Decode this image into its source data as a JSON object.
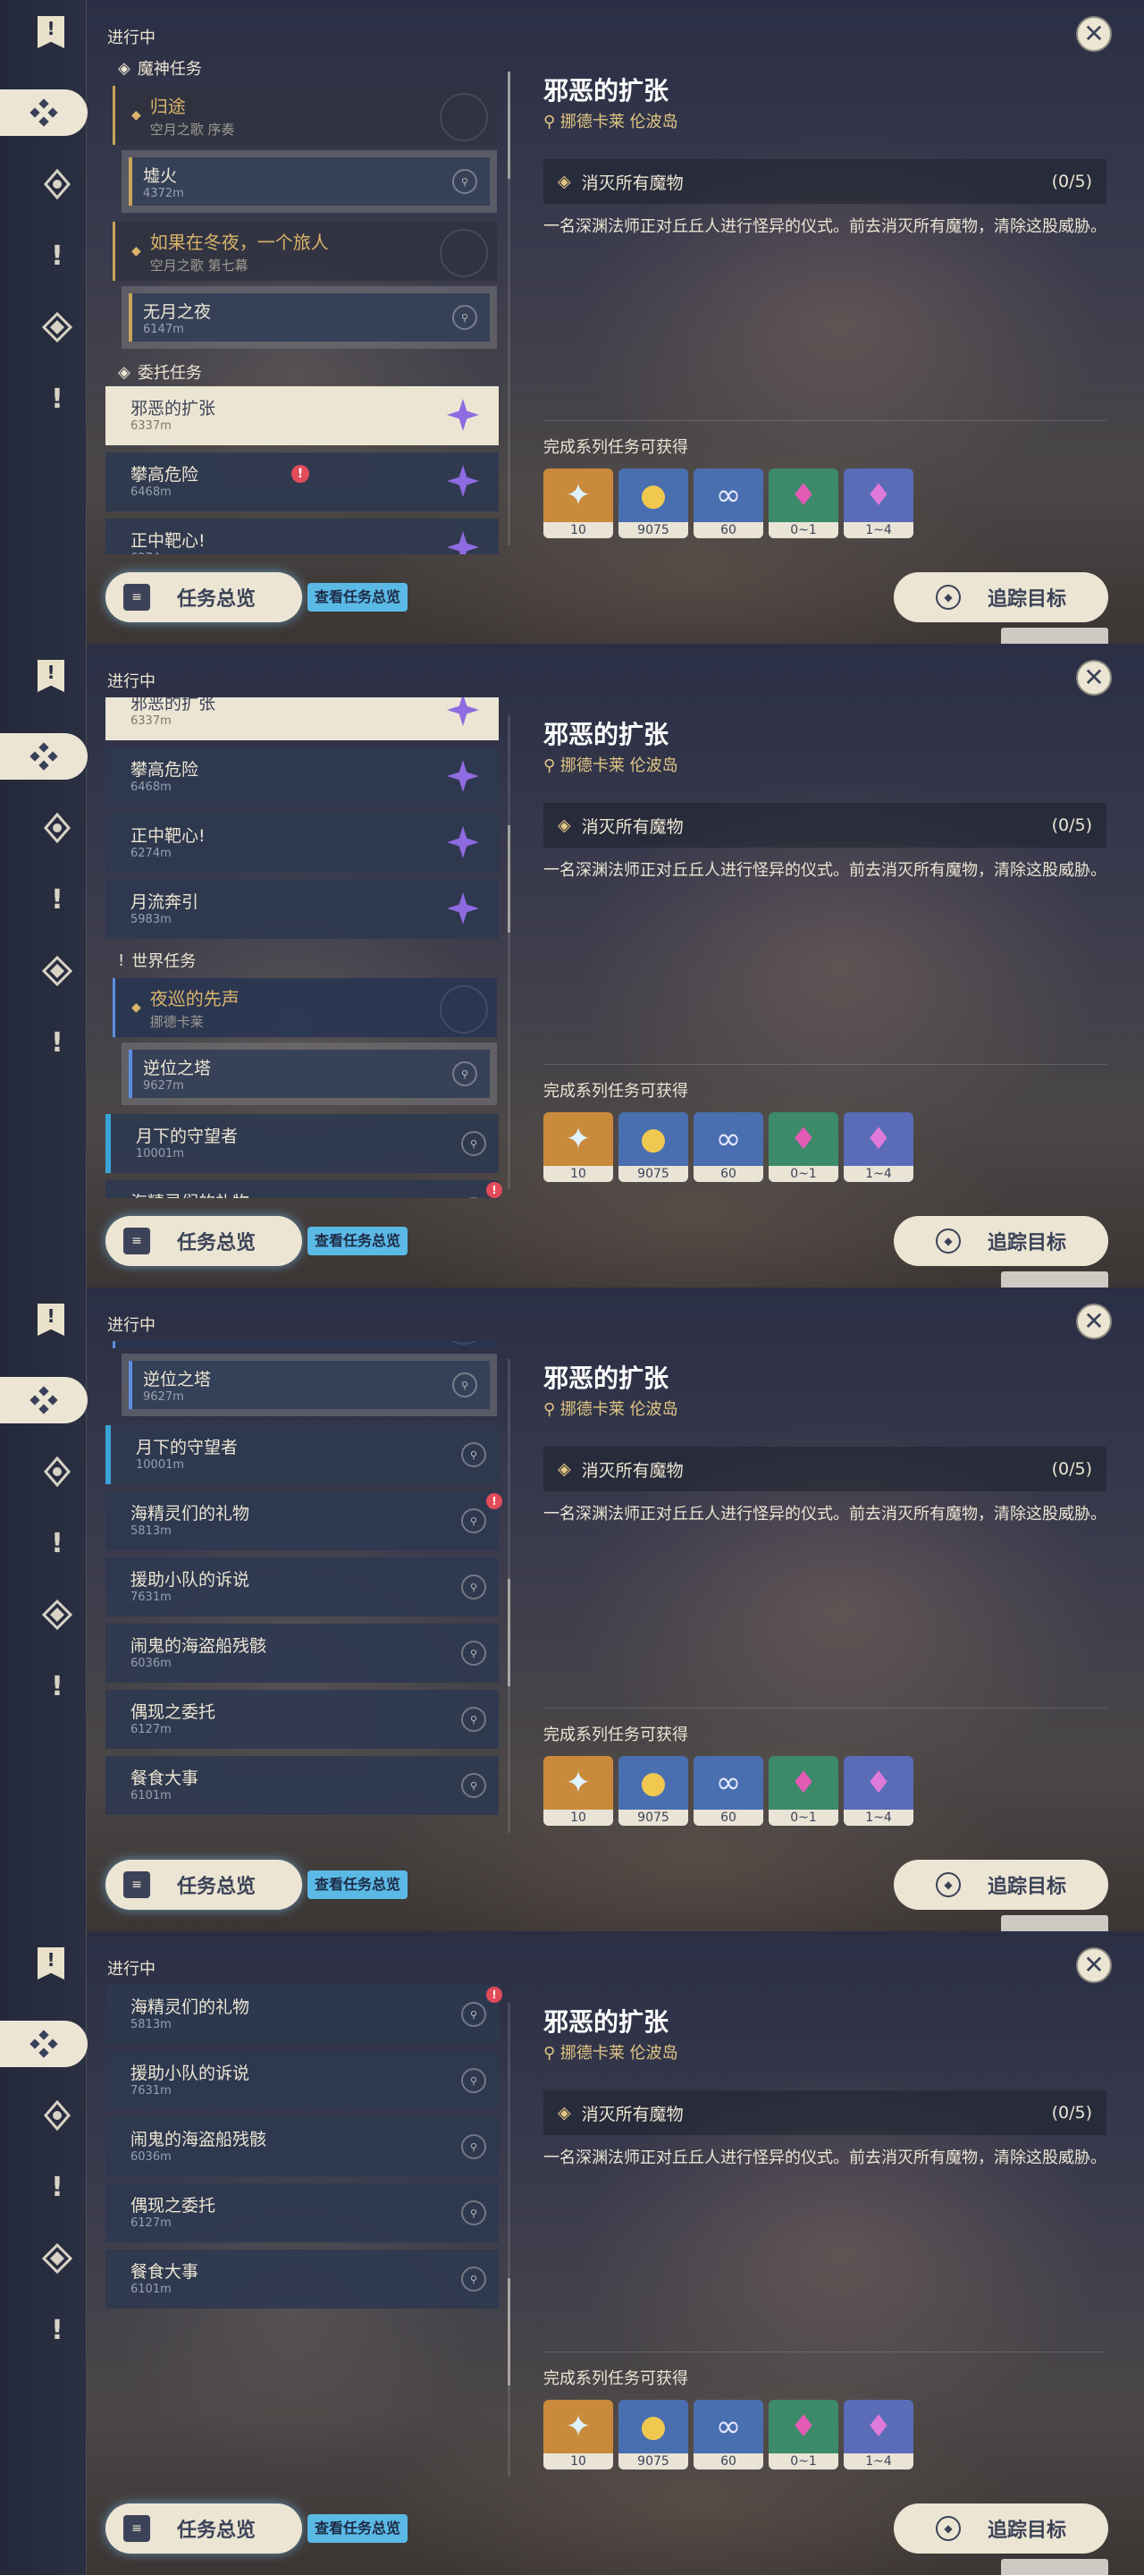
{
  "ui": {
    "status": "进行中",
    "overview_label": "任务总览",
    "overview_hint": "查看任务总览",
    "track_label": "追踪目标",
    "close_glyph": "✕"
  },
  "sections": {
    "archon": "魔神任务",
    "commission": "委托任务",
    "world": "世界任务"
  },
  "archon_quests": [
    {
      "title": "归途",
      "subtitle": "空月之歌 序奏",
      "step": "墟火",
      "distance": "4372m"
    },
    {
      "title": "如果在冬夜，一个旅人",
      "subtitle": "空月之歌 第七幕",
      "step": "无月之夜",
      "distance": "6147m"
    }
  ],
  "commissions": [
    {
      "title": "邪恶的扩张",
      "distance": "6337m"
    },
    {
      "title": "攀高危险",
      "distance": "6468m"
    },
    {
      "title": "正中靶心!",
      "distance": "6274m"
    },
    {
      "title": "月流奔引",
      "distance": "5983m"
    }
  ],
  "world_quest_main": {
    "title": "夜巡的先声",
    "subtitle": "挪德卡莱",
    "step": "逆位之塔",
    "distance": "9627m"
  },
  "world_quests": [
    {
      "title": "月下的守望者",
      "distance": "10001m"
    },
    {
      "title": "海精灵们的礼物",
      "distance": "5813m"
    },
    {
      "title": "援助小队的诉说",
      "distance": "7631m"
    },
    {
      "title": "闹鬼的海盗船残骸",
      "distance": "6036m"
    },
    {
      "title": "偶现之委托",
      "distance": "6127m"
    },
    {
      "title": "餐食大事",
      "distance": "6101m"
    }
  ],
  "detail": {
    "title": "邪恶的扩张",
    "location": "挪德卡莱 伦波岛",
    "objective": "消灭所有魔物",
    "progress": "(0/5)",
    "description": "一名深渊法师正对丘丘人进行怪异的仪式。前去消灭所有魔物，清除这股威胁。",
    "rewards_label": "完成系列任务可获得",
    "rewards": [
      {
        "icon": "primogem-icon",
        "qty": "10",
        "bg": "#c98a3b"
      },
      {
        "icon": "mora-icon",
        "qty": "9075",
        "bg": "#4a6fb0"
      },
      {
        "icon": "fellowship-icon",
        "qty": "60",
        "bg": "#4a6fb0"
      },
      {
        "icon": "crystal-green-icon",
        "qty": "0~1",
        "bg": "#3c8a6a"
      },
      {
        "icon": "crystal-purple-icon",
        "qty": "1~4",
        "bg": "#5a6cb8"
      }
    ]
  },
  "frames": [
    {
      "scroll_thumb": 0.0
    },
    {
      "scroll_thumb": 0.3
    },
    {
      "scroll_thumb": 0.6
    },
    {
      "scroll_thumb": 0.75
    }
  ]
}
